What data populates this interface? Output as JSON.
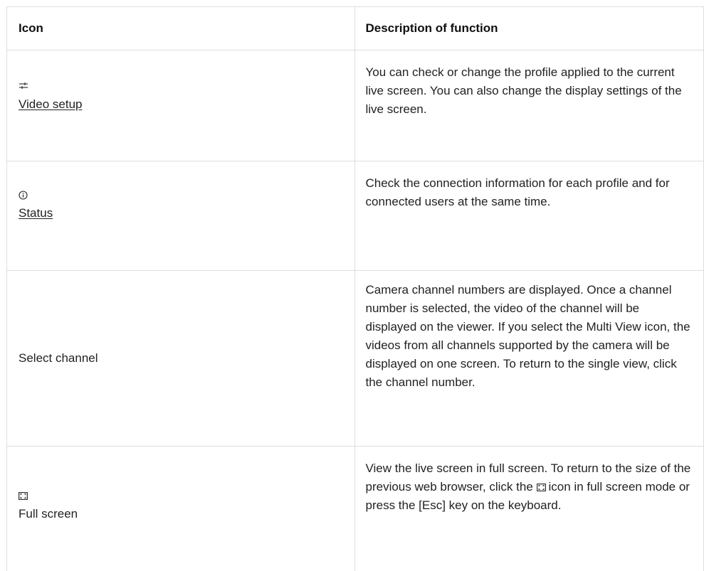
{
  "table": {
    "headers": {
      "icon": "Icon",
      "description": "Description of function"
    },
    "rows": [
      {
        "icon_name": "sliders-icon",
        "label": "Video setup",
        "label_is_link": true,
        "description": "You can check or change the profile applied to the current live screen. You can also change the display settings of the live screen."
      },
      {
        "icon_name": "info-circle-icon",
        "label": "Status",
        "label_is_link": true,
        "description": "Check the connection information for each profile and for connected users at the same time."
      },
      {
        "icon_name": "",
        "label": "Select channel",
        "label_is_link": false,
        "description": "Camera channel numbers are displayed. Once a channel number is selected, the video of the channel will be displayed on the viewer. If you select the Multi View icon, the videos from all channels supported by the camera will be displayed on one screen. To return to the single view, click the channel number."
      },
      {
        "icon_name": "fullscreen-icon",
        "label": "Full screen",
        "label_is_link": false,
        "description_before_icon": "View the live screen in full screen. To return to the size of the previous web browser, click the",
        "description_icon_name": "fullscreen-icon",
        "description_after_icon": "icon in full screen mode or press the [Esc] key on the keyboard."
      }
    ]
  },
  "colors": {
    "text": "#222222",
    "border": "#dedede",
    "background": "#ffffff"
  }
}
